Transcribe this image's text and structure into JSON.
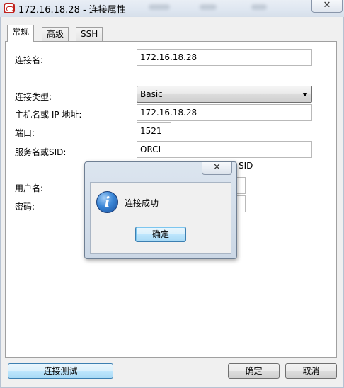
{
  "window": {
    "title": "172.16.18.28 - 连接属性",
    "close_glyph": "✕"
  },
  "tabs": [
    {
      "label": "常规",
      "active": true
    },
    {
      "label": "高级",
      "active": false
    },
    {
      "label": "SSH",
      "active": false
    }
  ],
  "form": {
    "connection_name_label": "连接名:",
    "connection_name_value": "172.16.18.28",
    "connection_type_label": "连接类型:",
    "connection_type_value": "Basic",
    "host_label": "主机名或 IP 地址:",
    "host_value": "172.16.18.28",
    "port_label": "端口:",
    "port_value": "1521",
    "service_label": "服务名或SID:",
    "service_value": "ORCL",
    "sid_partial_label": "SID",
    "username_label": "用户名:",
    "password_label": "密码:"
  },
  "buttons": {
    "test_connection": "连接测试",
    "ok": "确定",
    "cancel": "取消"
  },
  "dialog": {
    "message": "连接成功",
    "ok_label": "确定",
    "close_glyph": "✕",
    "icon_glyph": "i"
  },
  "colors": {
    "focus_button": "#a7d9f5",
    "brand_icon": "#c0211d"
  }
}
